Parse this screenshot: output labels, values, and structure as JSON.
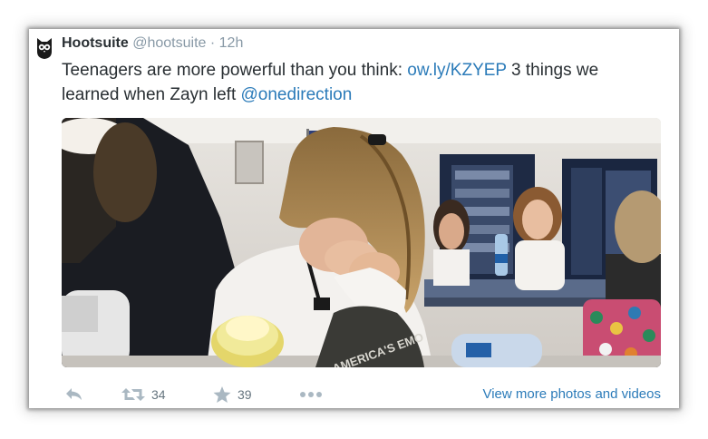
{
  "tweet": {
    "display_name": "Hootsuite",
    "handle": "@hootsuite",
    "separator": "·",
    "time": "12h",
    "text_part1": "Teenagers are more powerful than you think: ",
    "link": "ow.ly/KZYEP",
    "text_part2": " 3 things we learned when Zayn left ",
    "mention": "@onedirection"
  },
  "image": {
    "bag_text": "AMERICA'S EMO"
  },
  "actions": {
    "reply_icon": "reply-icon",
    "retweet_icon": "retweet-icon",
    "retweet_count": "34",
    "favorite_icon": "star-icon",
    "favorite_count": "39",
    "more_icon": "more-icon",
    "view_more": "View more photos and videos"
  },
  "colors": {
    "link": "#2b7bb9",
    "muted": "#8899a6",
    "text": "#292f33"
  }
}
